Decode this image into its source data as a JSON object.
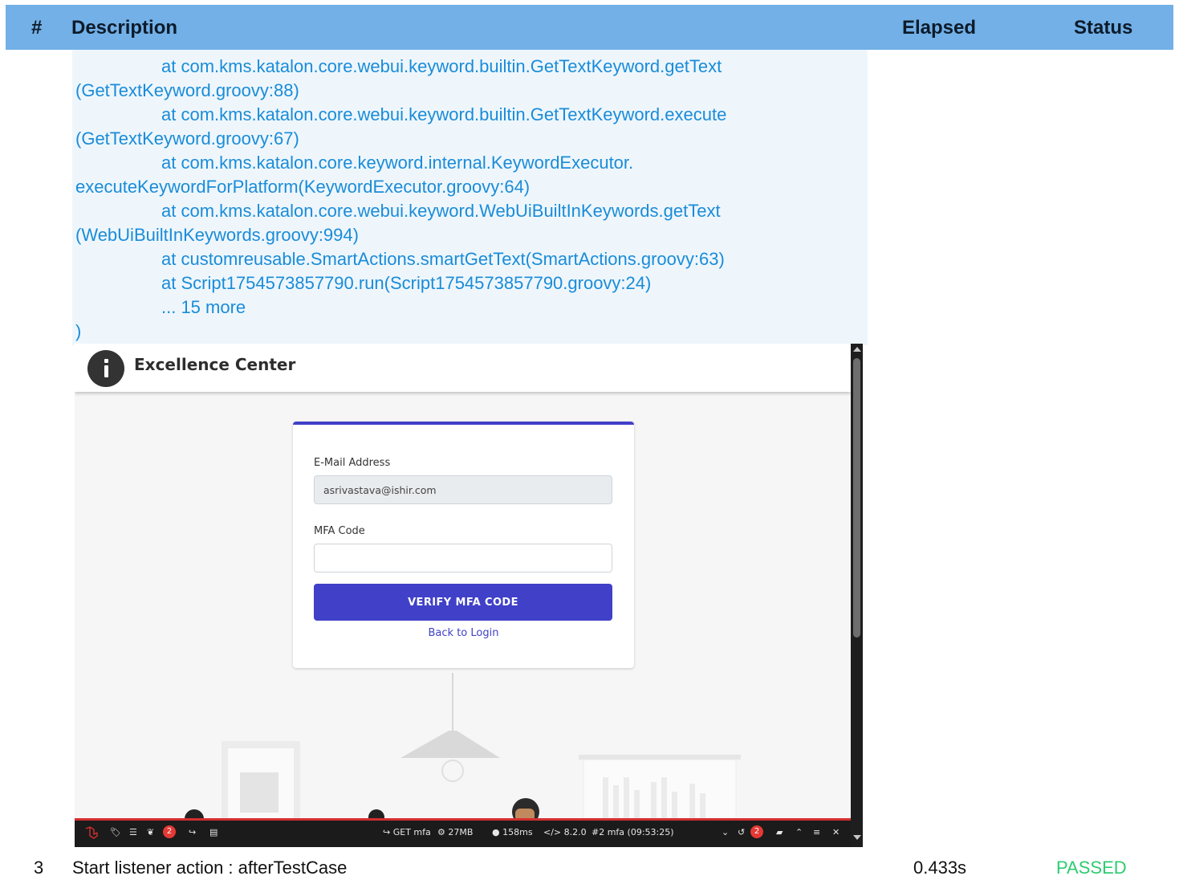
{
  "table": {
    "headers": {
      "num": "#",
      "description": "Description",
      "elapsed": "Elapsed",
      "status": "Status"
    }
  },
  "trace": {
    "lines": [
      "at com.kms.katalon.core.webui.keyword.builtin.GetTextKeyword.getText",
      "(GetTextKeyword.groovy:88)",
      "at com.kms.katalon.core.webui.keyword.builtin.GetTextKeyword.execute",
      "(GetTextKeyword.groovy:67)",
      "at com.kms.katalon.core.keyword.internal.KeywordExecutor.",
      "executeKeywordForPlatform(KeywordExecutor.groovy:64)",
      "at com.kms.katalon.core.webui.keyword.WebUiBuiltInKeywords.getText",
      "(WebUiBuiltInKeywords.groovy:994)",
      "at customreusable.SmartActions.smartGetText(SmartActions.groovy:63)",
      "at Script1754573857790.run(Script1754573857790.groovy:24)",
      "... 15 more",
      ")"
    ]
  },
  "screenshot": {
    "app_title": "Excellence Center",
    "email_label": "E-Mail Address",
    "email_value": "asrivastava@ishir.com",
    "mfa_label": "MFA Code",
    "mfa_value": "",
    "verify_button": "VERIFY MFA CODE",
    "back_link": "Back to Login",
    "accent_color": "#4040c8",
    "debugbar": {
      "route": "GET mfa",
      "memory": "27MB",
      "time": "158ms",
      "version": "8.2.0",
      "request": "#2 mfa (09:53:25)",
      "left_badge": "2",
      "right_badge": "2"
    }
  },
  "row": {
    "num": "3",
    "description": "Start listener action : afterTestCase",
    "elapsed": "0.433s",
    "status": "PASSED",
    "status_color": "#2ecc71"
  }
}
